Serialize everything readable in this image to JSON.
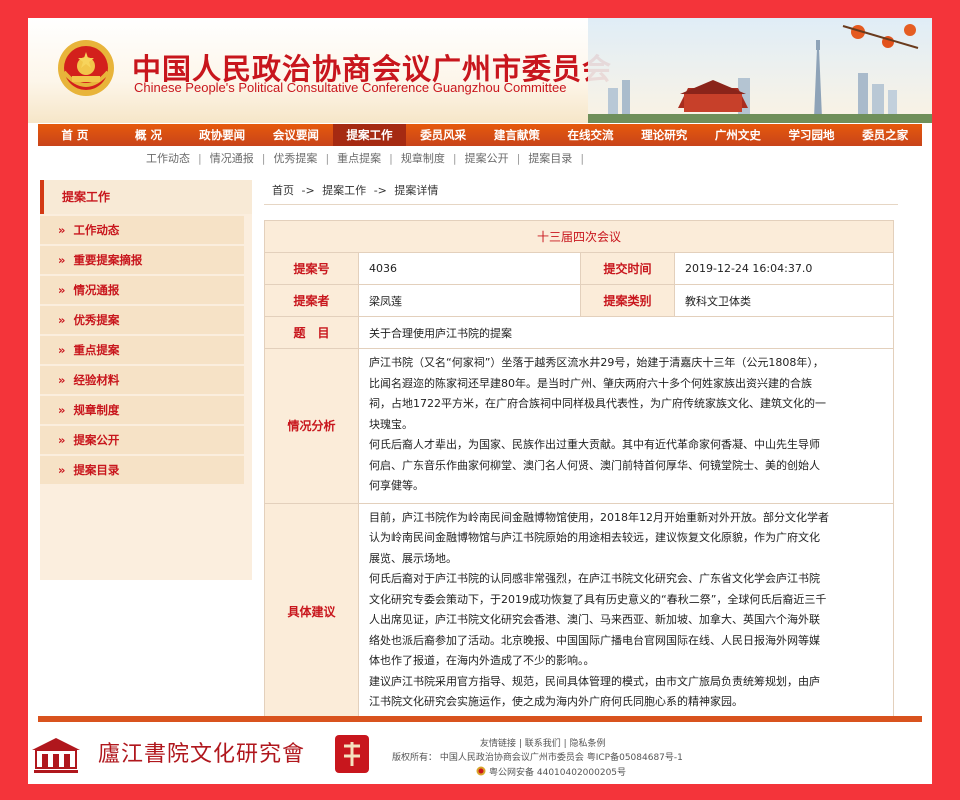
{
  "header": {
    "title_cn": "中国人民政治协商会议广州市委员会",
    "title_en": "Chinese People's Political Consultative Conference Guangzhou Committee"
  },
  "main_nav": [
    {
      "label": "首 页"
    },
    {
      "label": "概 况"
    },
    {
      "label": "政协要闻"
    },
    {
      "label": "会议要闻"
    },
    {
      "label": "提案工作",
      "active": true
    },
    {
      "label": "委员风采"
    },
    {
      "label": "建言献策"
    },
    {
      "label": "在线交流"
    },
    {
      "label": "理论研究"
    },
    {
      "label": "广州文史"
    },
    {
      "label": "学习园地"
    },
    {
      "label": "委员之家"
    }
  ],
  "sub_nav": [
    "工作动态",
    "情况通报",
    "优秀提案",
    "重点提案",
    "规章制度",
    "提案公开",
    "提案目录"
  ],
  "sidebar": {
    "heading": "提案工作",
    "items": [
      {
        "label": "工作动态"
      },
      {
        "label": "重要提案摘报"
      },
      {
        "label": "情况通报"
      },
      {
        "label": "优秀提案"
      },
      {
        "label": "重点提案"
      },
      {
        "label": "经验材料"
      },
      {
        "label": "规章制度"
      },
      {
        "label": "提案公开"
      },
      {
        "label": "提案目录"
      }
    ]
  },
  "breadcrumb": {
    "home": "首页",
    "sep": "->",
    "section": "提案工作",
    "current": "提案详情"
  },
  "detail": {
    "session": "十三届四次会议",
    "number_label": "提案号",
    "number": "4036",
    "submit_label": "提交时间",
    "submit_time": "2019-12-24 16:04:37.0",
    "proposer_label": "提案者",
    "proposer": "梁凤莲",
    "category_label": "提案类别",
    "category": "教科文卫体类",
    "subject_label": "题　目",
    "subject": "关于合理使用庐江书院的提案",
    "situation_label": "情况分析",
    "situation_lines": [
      "庐江书院（又名“何家祠”）坐落于越秀区流水井29号，始建于清嘉庆十三年（公元1808年），",
      "比闻名遐迩的陈家祠还早建80年。是当时广州、肇庆两府六十多个何姓家族出资兴建的合族",
      "祠，占地1722平方米，在广府合族祠中同样极具代表性，为广府传统家族文化、建筑文化的一",
      "块瑰宝。",
      "何氏后裔人才辈出，为国家、民族作出过重大贡献。其中有近代革命家何香凝、中山先生导师",
      "何启、广东音乐作曲家何柳堂、澳门名人何贤、澳门前特首何厚华、何镜堂院士、美的创始人",
      "何享健等。"
    ],
    "suggestion_label": "具体建议",
    "suggestion_lines": [
      "目前，庐江书院作为岭南民间金融博物馆使用，2018年12月开始重新对外开放。部分文化学者",
      "认为岭南民间金融博物馆与庐江书院原始的用途相去较远，建议恢复文化原貌，作为广府文化",
      "展览、展示场地。",
      "何氏后裔对于庐江书院的认同感非常强烈，在庐江书院文化研究会、广东省文化学会庐江书院",
      "文化研究专委会策动下，于2019成功恢复了具有历史意义的“春秋二祭”，全球何氏后裔近三千",
      "人出席见证，庐江书院文化研究会香港、澳门、马来西亚、新加坡、加拿大、英国六个海外联",
      "络处也派后裔参加了活动。北京晚报、中国国际广播电台官网国际在线、人民日报海外网等媒",
      "体也作了报道，在海内外造成了不少的影响。。",
      "建议庐江书院采用官方指导、规范，民间具体管理的模式，由市文广旅局负责统筹规划，由庐",
      "江书院文化研究会实施运作，使之成为海内外广府何氏同胞心系的精神家园。"
    ]
  },
  "footer": {
    "links": "友情链接 | 联系我们 | 隐私条例",
    "copyright": "版权所有：  中国人民政治协商会议广州市委员会    粤ICP备05084687号-1",
    "police": "粤公网安备 44010402000205号",
    "calligraphy": "廬江書院文化研究會"
  },
  "colors": {
    "brand_red": "#c8161d",
    "nav_orange": "#e65a0c",
    "cell_bg": "#fbecd9",
    "page_border": "#f4343a"
  },
  "icons": [
    "cppcc-emblem-icon",
    "city-skyline-illustration",
    "double-chevron-right-icon",
    "academy-building-logo",
    "seal-stamp-icon",
    "police-badge-icon"
  ]
}
